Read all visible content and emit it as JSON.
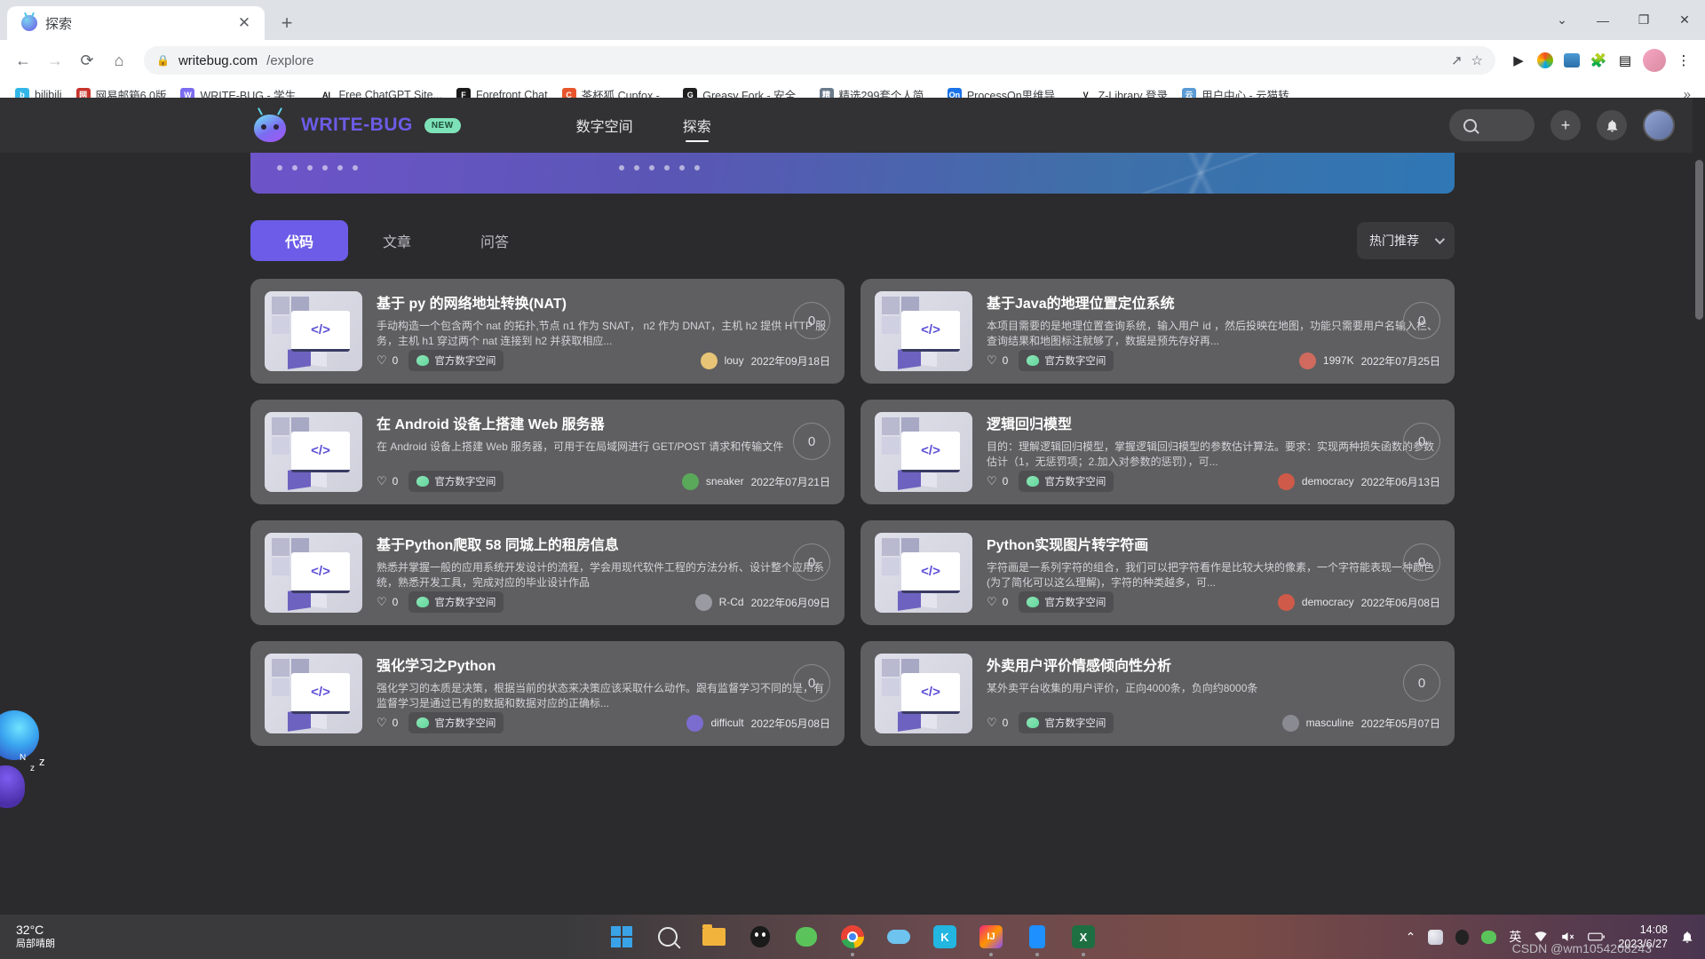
{
  "browser": {
    "tab": {
      "title": "探索",
      "close_label": "✕"
    },
    "newtab_label": "+",
    "window_controls": {
      "minimize_all": "⌄",
      "minimize": "—",
      "maximize": "❐",
      "close": "✕"
    },
    "toolbar": {
      "back": "←",
      "forward": "→",
      "reload": "⟳",
      "home": "⌂",
      "lock": "🔒",
      "url_host": "writebug.com",
      "url_path": "/explore",
      "url_full": "writebug.com/explore",
      "share": "↗",
      "bookmark_star": "☆",
      "media_play": "▶",
      "extensions_puzzle": "🧩",
      "sidepanel": "▤",
      "menu": "⋮"
    },
    "bookmarks": [
      {
        "label": "bilibili",
        "icon_color": "#32b6e8",
        "icon_text": "b"
      },
      {
        "label": "网易邮箱6.0版",
        "icon_color": "#c8332d",
        "icon_text": "网"
      },
      {
        "label": "WRITE-BUG - 学生...",
        "icon_color": "#7b6cf0",
        "icon_text": "W"
      },
      {
        "label": "Free ChatGPT Site...",
        "icon_color": "#ffffff",
        "icon_text": "AI"
      },
      {
        "label": "Forefront Chat",
        "icon_color": "#1a1a1a",
        "icon_text": "F"
      },
      {
        "label": "茶杯狐 Cupfox -...",
        "icon_color": "#e8552d",
        "icon_text": "C"
      },
      {
        "label": "Greasy Fork - 安全...",
        "icon_color": "#1f1f1f",
        "icon_text": "G"
      },
      {
        "label": "精选299套个人简...",
        "icon_color": "#6b7b8c",
        "icon_text": "精"
      },
      {
        "label": "ProcessOn思维导...",
        "icon_color": "#1a73e8",
        "icon_text": "On"
      },
      {
        "label": "Z-Library 登录",
        "icon_color": "#ffffff",
        "icon_text": "V"
      },
      {
        "label": "用户中心 - 云猫转...",
        "icon_color": "#5b9bd5",
        "icon_text": "云"
      }
    ],
    "bookmarks_overflow": "»"
  },
  "site": {
    "logo_text": "WRITE-BUG",
    "logo_badge": "NEW",
    "nav": [
      {
        "label": "数字空间",
        "active": false
      },
      {
        "label": "探索",
        "active": true
      }
    ],
    "search_placeholder": "",
    "add_button": "+",
    "notification_button": "🔔"
  },
  "filters": {
    "tabs": [
      {
        "label": "代码",
        "active": true
      },
      {
        "label": "文章",
        "active": false
      },
      {
        "label": "问答",
        "active": false
      }
    ],
    "sort": {
      "label": "热门推荐",
      "chevron": "⌄"
    }
  },
  "cards": [
    {
      "title": "基于 py 的网络地址转换(NAT)",
      "desc": "手动构造一个包含两个 nat 的拓扑,节点 n1 作为 SNAT， n2 作为 DNAT，主机 h2 提供 HTTP 服务，主机 h1 穿过两个 nat 连接到 h2 并获取相应...",
      "likes": "0",
      "tag": "官方数字空间",
      "author": "louy",
      "date": "2022年09月18日",
      "count": "0",
      "avatar_color": "#e8c477"
    },
    {
      "title": "基于Java的地理位置定位系统",
      "desc": "本项目需要的是地理位置查询系统，输入用户 id ，然后投映在地图，功能只需要用户名输入栏、查询结果和地图标注就够了，数据是预先存好再...",
      "likes": "0",
      "tag": "官方数字空间",
      "author": "1997K",
      "date": "2022年07月25日",
      "count": "0",
      "avatar_color": "#d06a5e"
    },
    {
      "title": "在 Android 设备上搭建 Web 服务器",
      "desc": "在 Android 设备上搭建 Web 服务器，可用于在局域网进行 GET/POST 请求和传输文件",
      "likes": "0",
      "tag": "官方数字空间",
      "author": "sneaker",
      "date": "2022年07月21日",
      "count": "0",
      "avatar_color": "#5aa85a"
    },
    {
      "title": "逻辑回归模型",
      "desc": "目的：理解逻辑回归模型，掌握逻辑回归模型的参数估计算法。要求：实现两种损失函数的参数估计（1，无惩罚项；2.加入对参数的惩罚），可...",
      "likes": "0",
      "tag": "官方数字空间",
      "author": "democracy",
      "date": "2022年06月13日",
      "count": "0",
      "avatar_color": "#cf5a4a"
    },
    {
      "title": "基于Python爬取 58 同城上的租房信息",
      "desc": "熟悉并掌握一般的应用系统开发设计的流程，学会用现代软件工程的方法分析、设计整个应用系统，熟悉开发工具，完成对应的毕业设计作品",
      "likes": "0",
      "tag": "官方数字空间",
      "author": "R-Cd",
      "date": "2022年06月09日",
      "count": "0",
      "avatar_color": "#9a9aa2"
    },
    {
      "title": "Python实现图片转字符画",
      "desc": "字符画是一系列字符的组合，我们可以把字符看作是比较大块的像素，一个字符能表现一种颜色(为了简化可以这么理解)，字符的种类越多，可...",
      "likes": "0",
      "tag": "官方数字空间",
      "author": "democracy",
      "date": "2022年06月08日",
      "count": "0",
      "avatar_color": "#cf5a4a"
    },
    {
      "title": "强化学习之Python",
      "desc": "强化学习的本质是决策，根据当前的状态来决策应该采取什么动作。跟有监督学习不同的是，有监督学习是通过已有的数据和数据对应的正确标...",
      "likes": "0",
      "tag": "官方数字空间",
      "author": "difficult",
      "date": "2022年05月08日",
      "count": "0",
      "avatar_color": "#7b6cd0"
    },
    {
      "title": "外卖用户评价情感倾向性分析",
      "desc": "某外卖平台收集的用户评价，正向4000条，负向约8000条",
      "likes": "0",
      "tag": "官方数字空间",
      "author": "masculine",
      "date": "2022年05月07日",
      "count": "0",
      "avatar_color": "#8a8a92"
    }
  ],
  "taskbar": {
    "weather_temp": "32°C",
    "weather_desc": "局部晴朗",
    "apps": [
      {
        "name": "windows-start",
        "label": ""
      },
      {
        "name": "search",
        "label": ""
      },
      {
        "name": "file-explorer",
        "label": ""
      },
      {
        "name": "qq-music",
        "label": ""
      },
      {
        "name": "wechat",
        "label": ""
      },
      {
        "name": "chrome",
        "label": ""
      },
      {
        "name": "onedrive",
        "label": ""
      },
      {
        "name": "kugou",
        "label": "K"
      },
      {
        "name": "intellij-idea",
        "label": "IJ"
      },
      {
        "name": "phone-link",
        "label": ""
      },
      {
        "name": "excel",
        "label": "X"
      }
    ],
    "tray": {
      "chevron": "⌃",
      "items": [
        "drive",
        "qq",
        "wechat",
        "ime"
      ],
      "ime_label": "英",
      "wifi": "wifi-icon",
      "volume": "volume-muted-icon",
      "battery": "battery-icon"
    },
    "clock_time": "14:08",
    "clock_date": "2023/6/27"
  },
  "watermark": "CSDN @wm1054208243"
}
